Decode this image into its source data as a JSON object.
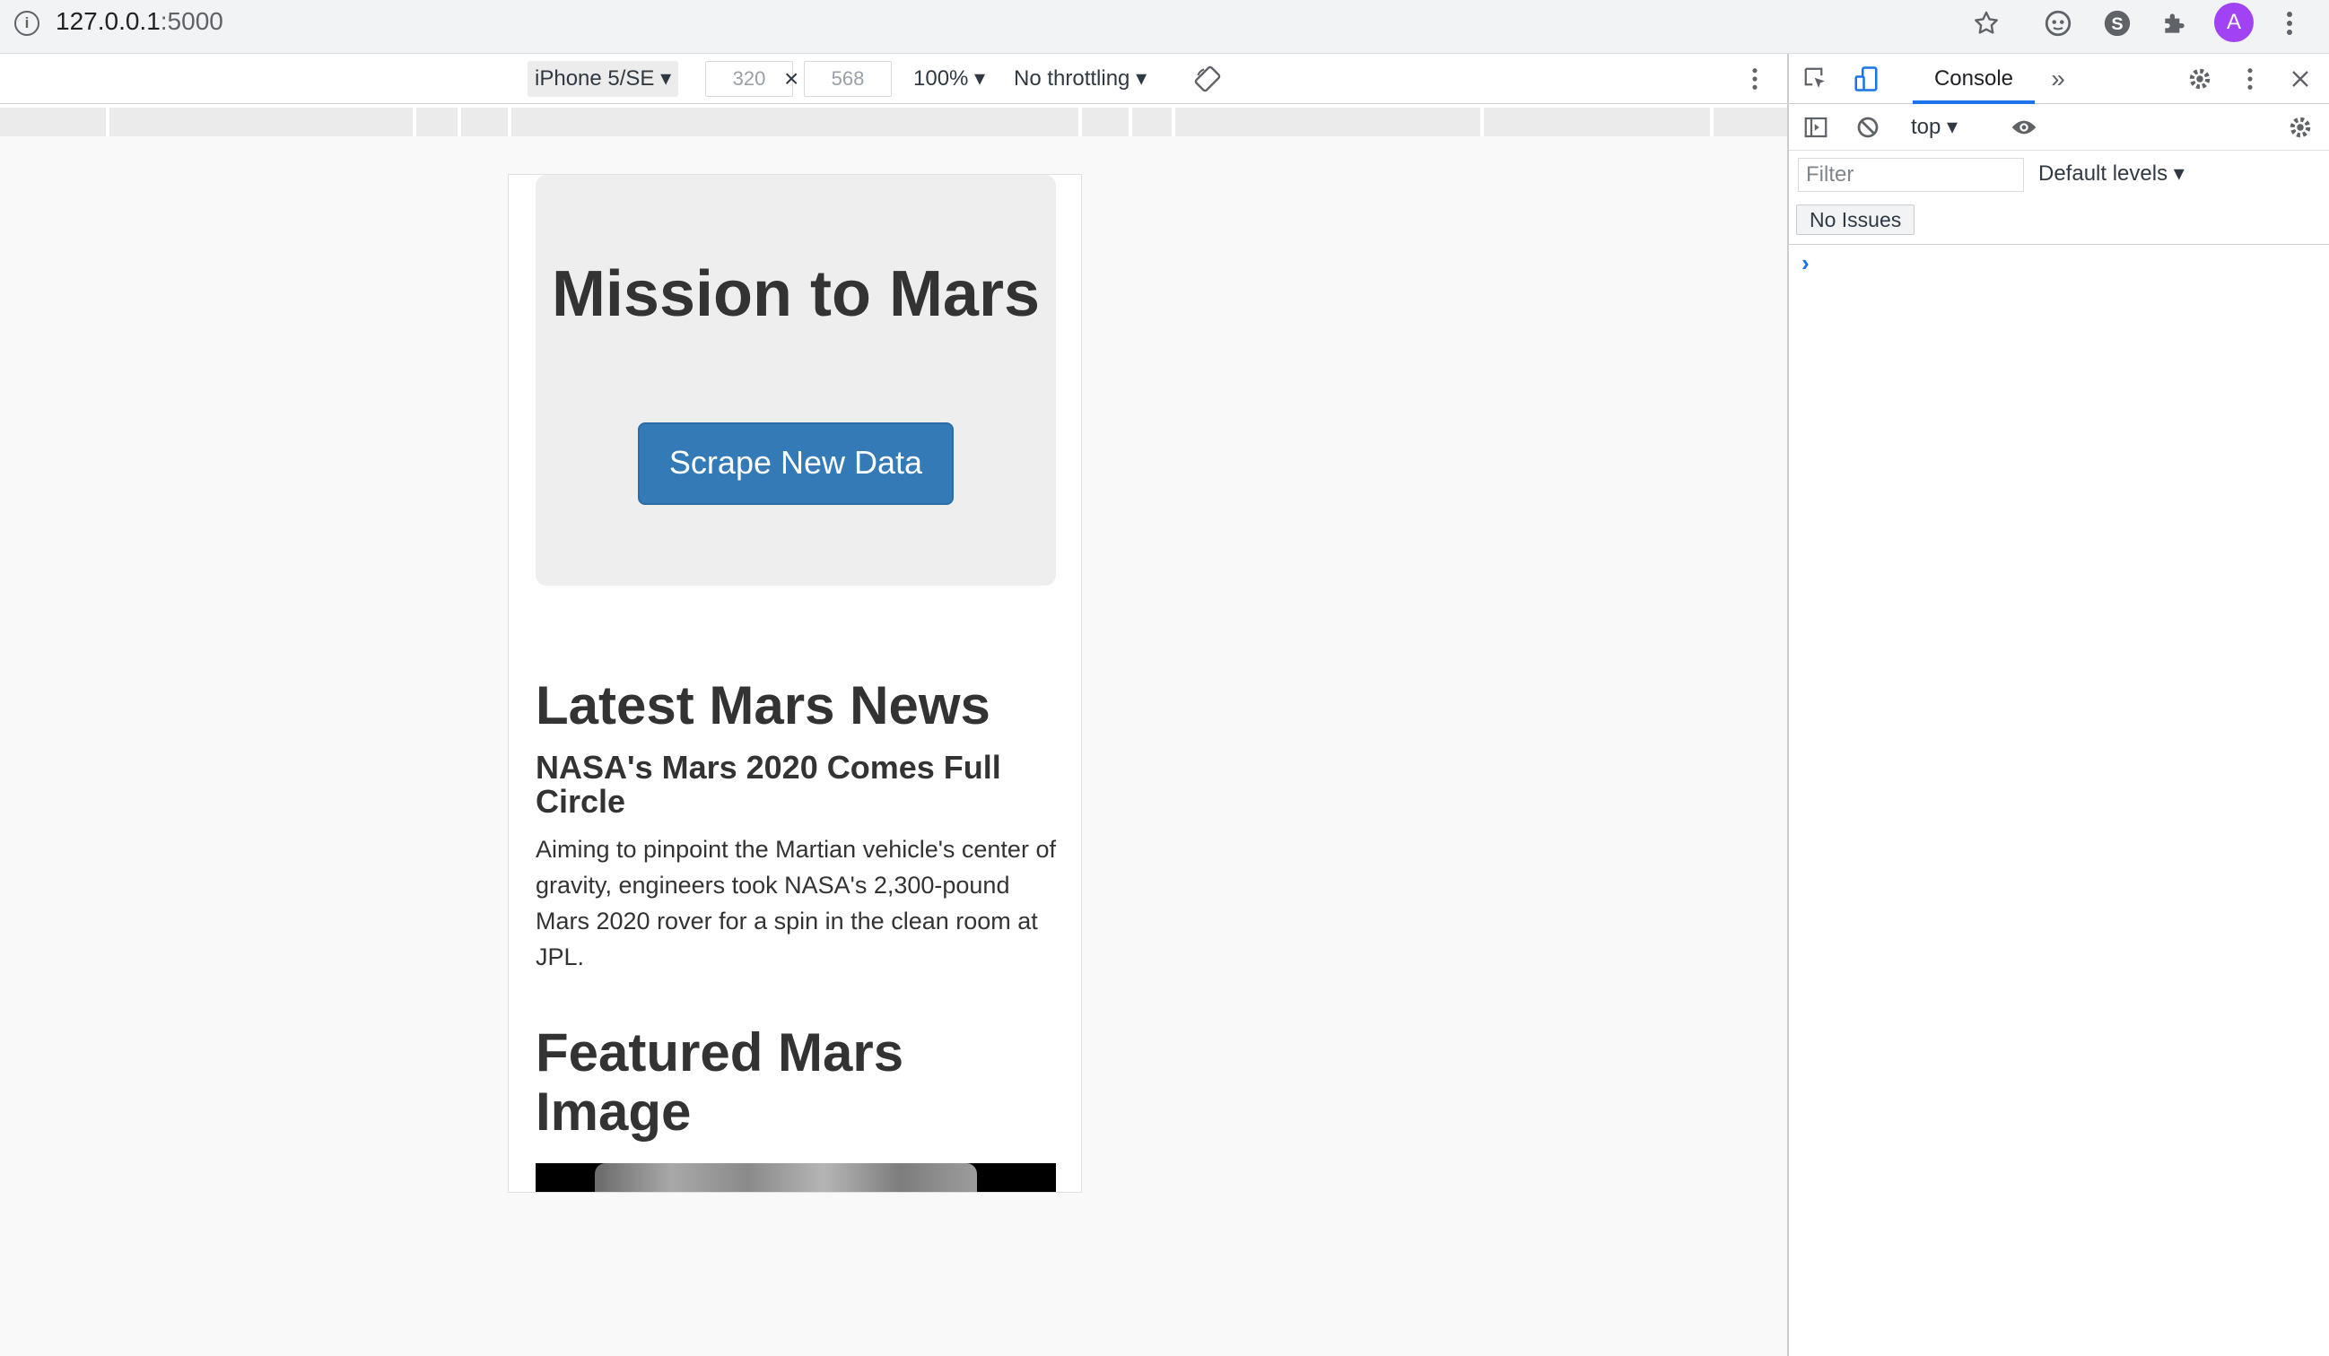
{
  "browser": {
    "url_host": "127.0.0.1",
    "url_port": ":5000",
    "avatar_letter": "A"
  },
  "device_toolbar": {
    "device": "iPhone 5/SE",
    "width": "320",
    "height": "568",
    "dim_separator": "×",
    "zoom": "100%",
    "throttling": "No throttling"
  },
  "page": {
    "title": "Mission to Mars",
    "scrape_button": "Scrape New Data",
    "news_heading": "Latest Mars News",
    "news_title": "NASA's Mars 2020 Comes Full Circle",
    "news_paragraph": "Aiming to pinpoint the Martian vehicle's center of gravity, engineers took NASA's 2,300-pound Mars 2020 rover for a spin in the clean room at JPL.",
    "featured_heading": "Featured Mars Image"
  },
  "devtools": {
    "tab": "Console",
    "context": "top",
    "filter_placeholder": "Filter",
    "levels": "Default levels",
    "issues": "No Issues",
    "prompt": "›"
  },
  "colors": {
    "button": "#337ab7",
    "jumbotron": "#eeeeee",
    "accent": "#1a73e8",
    "avatar": "#a142f4"
  }
}
